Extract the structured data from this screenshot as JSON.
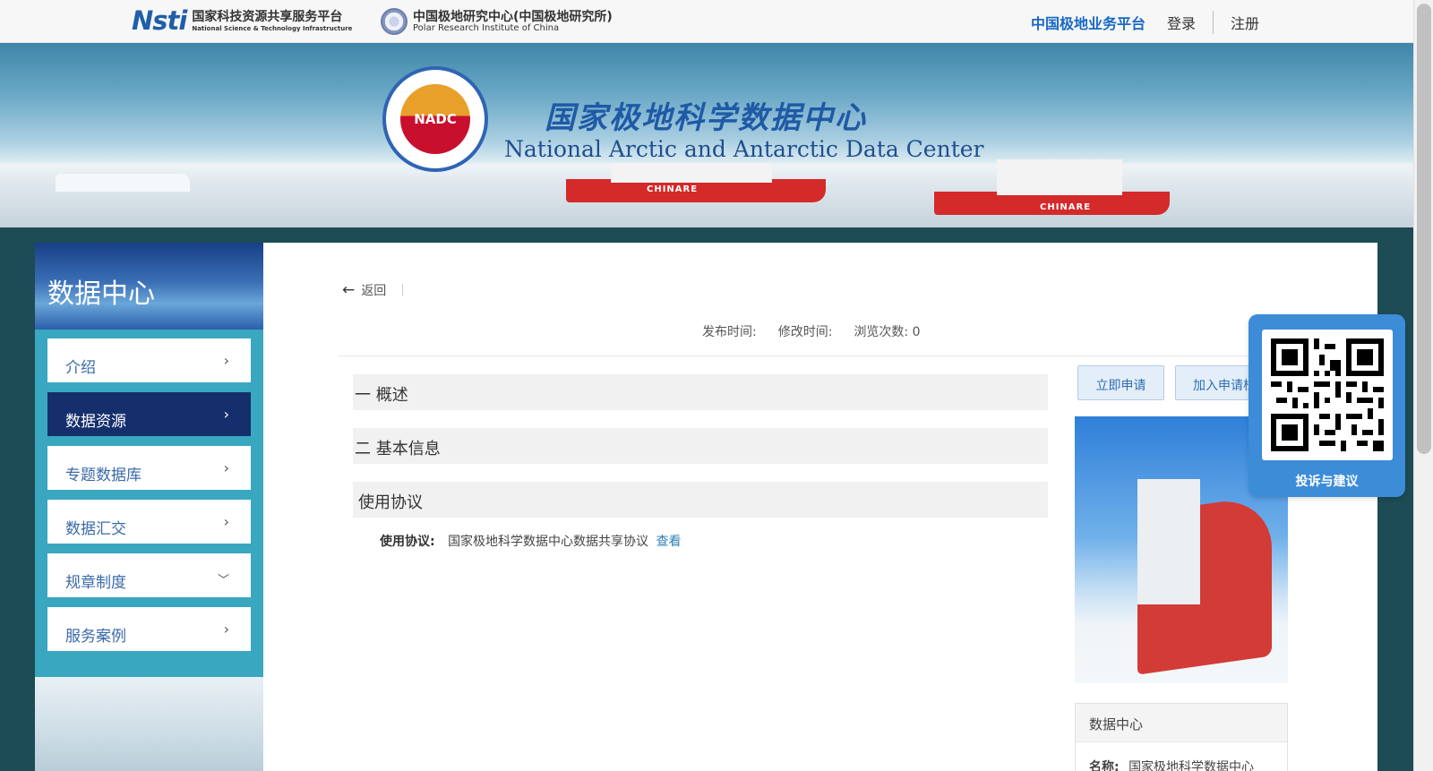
{
  "header": {
    "nsti_logo_mark": "Nsti",
    "nsti_name_cn": "国家科技资源共享服务平台",
    "nsti_name_en": "National Science & Technology Infrastructure",
    "pric_name_cn": "中国极地研究中心(中国极地研究所)",
    "pric_name_en": "Polar Research Institute of China",
    "platform_link": "中国极地业务平台",
    "login_link": "登录",
    "register_link": "注册"
  },
  "banner": {
    "logo_text": "NADC",
    "title_cn": "国家极地科学数据中心",
    "title_en": "National Arctic and Antarctic Data Center",
    "ship_name": "CHINARE"
  },
  "sidebar": {
    "title": "数据中心",
    "items": [
      {
        "label": "介绍",
        "icon": "chevron-right-icon"
      },
      {
        "label": "数据资源",
        "icon": "chevron-right-icon",
        "active": true
      },
      {
        "label": "专题数据库",
        "icon": "chevron-right-icon"
      },
      {
        "label": "数据汇交",
        "icon": "chevron-right-icon"
      },
      {
        "label": "规章制度",
        "icon": "chevron-down-icon"
      },
      {
        "label": "服务案例",
        "icon": "chevron-right-icon"
      }
    ]
  },
  "main": {
    "back_label": "返回",
    "meta": {
      "publish_label": "发布时间:",
      "modify_label": "修改时间:",
      "views_label": "浏览次数:",
      "views_value": "0"
    },
    "sections": [
      {
        "label": "一 概述"
      },
      {
        "label": "二 基本信息"
      },
      {
        "label": "使用协议"
      }
    ],
    "agreement": {
      "label": "使用协议:",
      "value": "国家极地科学数据中心数据共享协议",
      "link": "查看"
    },
    "apply_button": "立即申请",
    "cart_button": "加入申请栏",
    "info_card": {
      "title": "数据中心",
      "name_label": "名称:",
      "name_value": "国家极地科学数据中心"
    }
  },
  "qr_widget": {
    "label": "投诉与建议"
  },
  "colors": {
    "accent": "#1768c4",
    "sidebar_bg": "#3aa7c0",
    "sidebar_active": "#152f6d",
    "qr_bg": "#3d8cd8"
  }
}
